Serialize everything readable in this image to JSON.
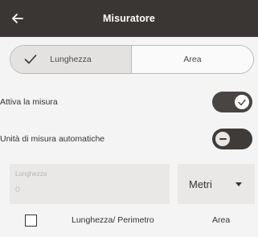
{
  "app_bar": {
    "title": "Misuratore",
    "back_icon": "arrow-left-icon"
  },
  "segmented_control": {
    "options": [
      {
        "label": "Lunghezza",
        "selected": true,
        "icon": "check-icon"
      },
      {
        "label": "Area",
        "selected": false
      }
    ]
  },
  "settings": {
    "activate_measure": {
      "label": "Attiva la misura",
      "on": true
    },
    "auto_units": {
      "label": "Unità di misura automatiche",
      "on": false
    }
  },
  "length_input": {
    "label": "Lunghezza",
    "value": "0"
  },
  "unit_select": {
    "value": "Metri",
    "icon": "caret-down-icon"
  },
  "list_header": {
    "checked": false,
    "col1": "Lunghezza/ Perimetro",
    "col2": "Area"
  },
  "colors": {
    "app_bar": "#3a3633",
    "background": "#f4f4f4",
    "toggle": "#4a4542",
    "selected_segment": "#e4e2e1"
  }
}
